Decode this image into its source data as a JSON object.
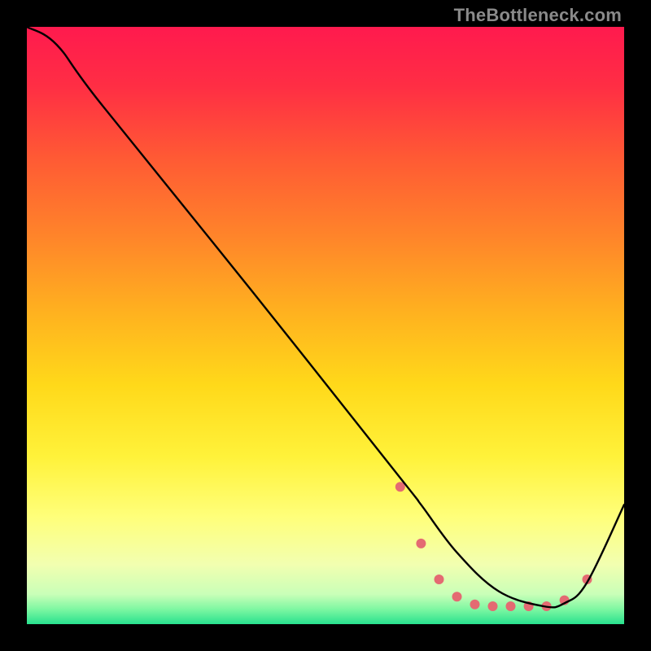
{
  "watermark": "TheBottleneck.com",
  "gradient_stops": [
    {
      "offset": 0.0,
      "color": "#ff1a4e"
    },
    {
      "offset": 0.1,
      "color": "#ff2e44"
    },
    {
      "offset": 0.22,
      "color": "#ff5a34"
    },
    {
      "offset": 0.35,
      "color": "#ff842a"
    },
    {
      "offset": 0.48,
      "color": "#ffb21f"
    },
    {
      "offset": 0.6,
      "color": "#ffd91a"
    },
    {
      "offset": 0.72,
      "color": "#fff23a"
    },
    {
      "offset": 0.82,
      "color": "#ffff7a"
    },
    {
      "offset": 0.9,
      "color": "#f2ffb0"
    },
    {
      "offset": 0.95,
      "color": "#c9ffb8"
    },
    {
      "offset": 0.975,
      "color": "#7ef7a2"
    },
    {
      "offset": 1.0,
      "color": "#28e18e"
    }
  ],
  "chart_data": {
    "type": "line",
    "title": "",
    "xlabel": "",
    "ylabel": "",
    "xlim": [
      0,
      1
    ],
    "ylim": [
      0,
      1
    ],
    "series": [
      {
        "name": "curve",
        "x": [
          0.0,
          0.05,
          0.125,
          0.375,
          0.625,
          0.66,
          0.72,
          0.79,
          0.865,
          0.9,
          0.938,
          1.0
        ],
        "values": [
          1.0,
          0.97,
          0.87,
          0.56,
          0.245,
          0.2,
          0.12,
          0.055,
          0.03,
          0.035,
          0.07,
          0.2
        ]
      }
    ],
    "markers": {
      "name": "dot-band",
      "color": "#e46a72",
      "x": [
        0.625,
        0.66,
        0.69,
        0.72,
        0.75,
        0.78,
        0.81,
        0.84,
        0.87,
        0.9,
        0.938
      ],
      "values": [
        0.23,
        0.135,
        0.075,
        0.046,
        0.033,
        0.03,
        0.03,
        0.03,
        0.03,
        0.04,
        0.075
      ]
    }
  }
}
